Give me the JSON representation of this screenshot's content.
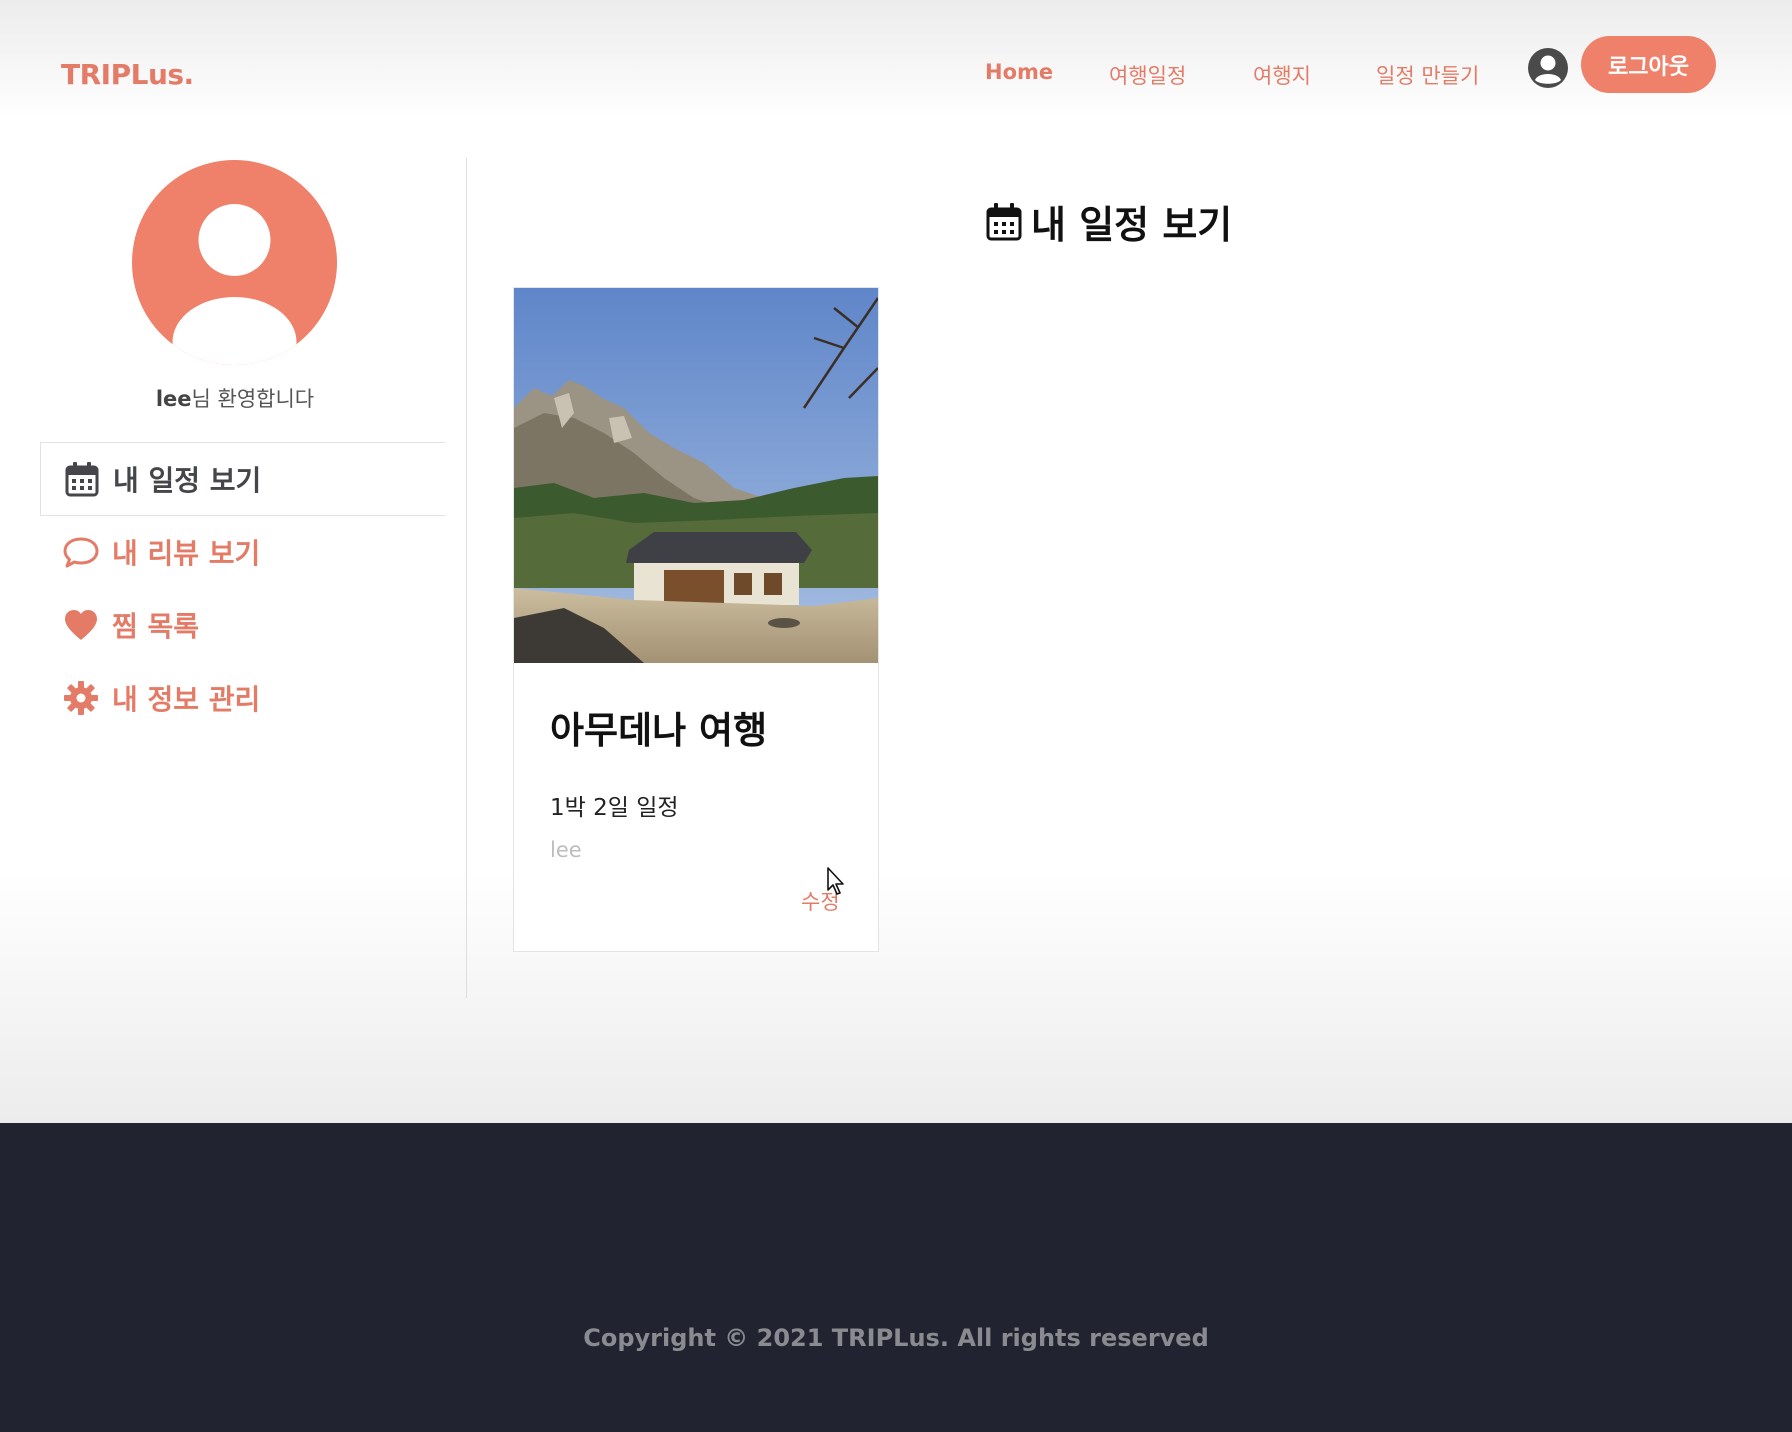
{
  "header": {
    "logo": "TRIPLus.",
    "nav": [
      {
        "label": "Home"
      },
      {
        "label": "여행일정"
      },
      {
        "label": "여행지"
      },
      {
        "label": "일정 만들기"
      }
    ],
    "logout_label": "로그아웃"
  },
  "sidebar": {
    "username": "lee",
    "welcome_suffix": "님 환영합니다",
    "items": [
      {
        "label": "내 일정 보기",
        "icon": "calendar-icon"
      },
      {
        "label": "내 리뷰 보기",
        "icon": "speech-bubble-icon"
      },
      {
        "label": "찜 목록",
        "icon": "heart-icon"
      },
      {
        "label": "내 정보 관리",
        "icon": "gear-icon"
      }
    ]
  },
  "main": {
    "title": "내 일정 보기",
    "cards": [
      {
        "title": "아무데나 여행",
        "subtitle": "1박 2일 일정",
        "author": "lee",
        "edit_label": "수정"
      }
    ]
  },
  "footer": {
    "copyright": "Copyright © 2021 TRIPLus. All rights reserved"
  },
  "colors": {
    "accent": "#ef8069",
    "footer_bg": "#212430",
    "active_text": "#44464a"
  }
}
